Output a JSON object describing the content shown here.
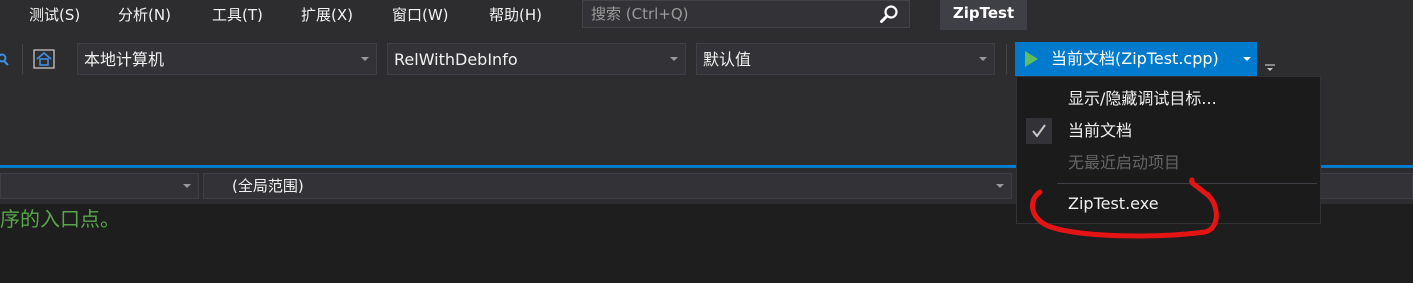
{
  "menu": {
    "items": [
      "测试(S)",
      "分析(N)",
      "工具(T)",
      "扩展(X)",
      "窗口(W)",
      "帮助(H)"
    ]
  },
  "search": {
    "placeholder": "搜索 (Ctrl+Q)"
  },
  "window": {
    "title": "ZipTest"
  },
  "toolbar": {
    "target": "本地计算机",
    "configuration": "RelWithDebInfo",
    "default_value": "默认值",
    "start_label": "当前文档(ZipTest.cpp)"
  },
  "startup_menu": {
    "show_hide_targets": "显示/隐藏调试目标...",
    "current_document": "当前文档",
    "current_document_checked": true,
    "no_recent_items": "无最近启动项目",
    "exe_item": "ZipTest.exe"
  },
  "navbar": {
    "scope": "(全局范围)"
  },
  "editor": {
    "comment_text": "序的入口点。"
  },
  "colors": {
    "accent": "#007acc",
    "play": "#5cbd61",
    "comment": "#57a64a",
    "annotation": "#e41414",
    "disabled_text": "#656565"
  },
  "icons": [
    "search-icon",
    "home-icon",
    "play-icon",
    "check-icon",
    "chevron-down-icon",
    "overflow-icon"
  ]
}
